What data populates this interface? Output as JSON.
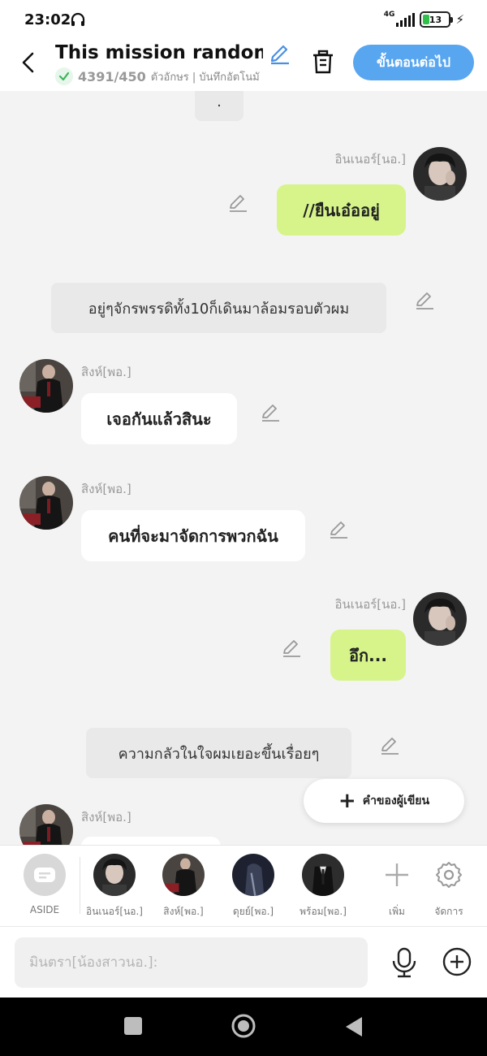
{
  "status": {
    "time": "23:02",
    "network": "4G",
    "battery": "13"
  },
  "header": {
    "title": "This mission randoml...",
    "char_count": "4391/450",
    "count_suffix": "ตัวอักษร | บันทึกอัตโนมั",
    "next_label": "ขั้นตอนต่อไป"
  },
  "messages": {
    "top_narration": ".",
    "m1_name": "อินเนอร์[นอ.]",
    "m1_text": "//ยืนเอ๋ออยู่",
    "narration2": "อยู่ๆจักรพรรดิทั้ง10ก็เดินมาล้อมรอบตัวผม",
    "m3_name": "สิงห์[พอ.]",
    "m3_text": "เจอกันแล้วสินะ",
    "m4_name": "สิงห์[พอ.]",
    "m4_text": "คนที่จะมาจัดการพวกฉัน",
    "m5_name": "อินเนอร์[นอ.]",
    "m5_text": "อึก...",
    "narration6": "ความกลัวในใจผมเยอะขึ้นเรื่อยๆ",
    "m7_name": "สิงห์[พอ.]"
  },
  "fab": {
    "label": "คำของผู้เขียน"
  },
  "characters": [
    {
      "label": "ASIDE"
    },
    {
      "label": "อินเนอร์[นอ.]"
    },
    {
      "label": "สิงห์[พอ.]"
    },
    {
      "label": "ดุยย์[พอ.]"
    },
    {
      "label": "พร้อม[พอ.]"
    },
    {
      "label": "เพิ่ม"
    },
    {
      "label": "จัดการ"
    }
  ],
  "input": {
    "placeholder": "มินตรา[น้องสาวนอ.]:"
  },
  "colors": {
    "accent": "#58a6f0",
    "bubble_right": "#d6f48a",
    "bubble_left": "#ffffff",
    "narration": "#e9e9e9"
  }
}
